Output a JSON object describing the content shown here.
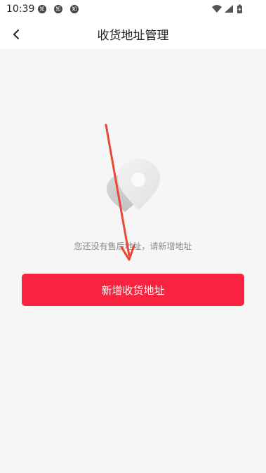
{
  "status_bar": {
    "time": "10:39",
    "notifications": [
      "知",
      "知",
      "知"
    ],
    "icons": [
      "wifi-icon",
      "signal-icon",
      "battery-icon"
    ]
  },
  "header": {
    "title": "收货地址管理",
    "back_icon": "chevron-left-icon"
  },
  "empty_state": {
    "icon": "location-pin-icon",
    "message": "您还没有售后地址，请新增地址"
  },
  "actions": {
    "add_address_label": "新增收货地址"
  },
  "colors": {
    "accent": "#f8233e",
    "annotation_arrow": "#e8483a",
    "page_background": "#f6f6f6"
  }
}
